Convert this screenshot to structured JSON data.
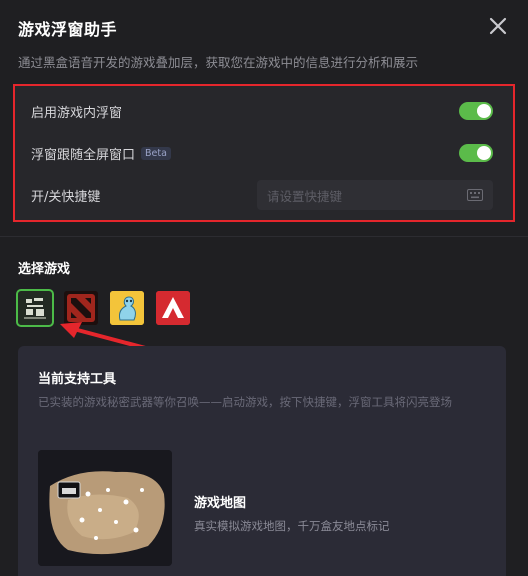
{
  "header": {
    "title": "游戏浮窗助手",
    "subtitle": "通过黑盒语音开发的游戏叠加层，获取您在游戏中的信息进行分析和展示"
  },
  "settings": {
    "enable_overlay_label": "启用游戏内浮窗",
    "enable_overlay_on": true,
    "follow_fullscreen_label": "浮窗跟随全屏窗口",
    "beta_badge": "Beta",
    "follow_fullscreen_on": true,
    "hotkey_label": "开/关快捷键",
    "hotkey_placeholder": "请设置快捷键"
  },
  "games": {
    "section_title": "选择游戏",
    "items": [
      {
        "icon": "game-icon-1",
        "selected": true
      },
      {
        "icon": "dota2-icon",
        "selected": false
      },
      {
        "icon": "game-icon-3",
        "selected": false
      },
      {
        "icon": "apex-icon",
        "selected": false
      }
    ]
  },
  "tool_card": {
    "title": "当前支持工具",
    "description": "已实装的游戏秘密武器等你召唤——启动游戏，按下快捷键，浮窗工具将闪亮登场",
    "tool_name": "游戏地图",
    "tool_desc": "真实模拟游戏地图，千万盒友地点标记"
  },
  "colors": {
    "accent_green": "#5bbb4a",
    "highlight_red": "#e5262c"
  }
}
